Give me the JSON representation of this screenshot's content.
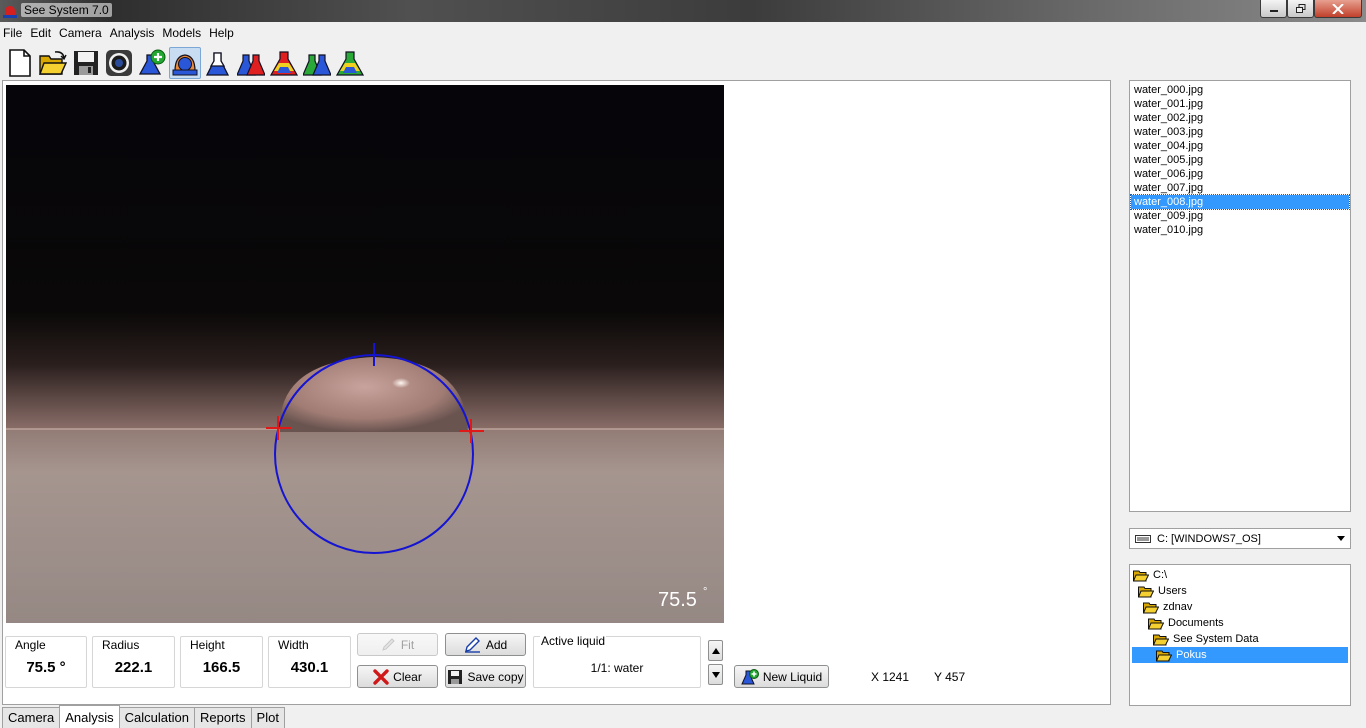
{
  "window": {
    "title": "See System 7.0"
  },
  "menu": [
    "File",
    "Edit",
    "Camera",
    "Analysis",
    "Models",
    "Help"
  ],
  "toolbar": {
    "icons": [
      "new-document-icon",
      "open-folder-icon",
      "save-disk-icon",
      "camera-lens-icon",
      "add-flask-icon",
      "drop-capture-icon",
      "blue-flask-icon",
      "blue-red-flask-icon",
      "red-yellow-flask-icon",
      "green-blue-flask-icon",
      "green-yellow-flask-icon"
    ],
    "pressed_index": 5
  },
  "image": {
    "angle_overlay": "75.5",
    "angle_unit": "°"
  },
  "measurements": {
    "angle": {
      "label": "Angle",
      "value": "75.5 °"
    },
    "radius": {
      "label": "Radius",
      "value": "222.1"
    },
    "height": {
      "label": "Height",
      "value": "166.5"
    },
    "width": {
      "label": "Width",
      "value": "430.1"
    }
  },
  "buttons": {
    "fit": "Fit",
    "add": "Add",
    "clear": "Clear",
    "save_copy": "Save copy",
    "new_liquid": "New Liquid"
  },
  "active_liquid": {
    "label": "Active liquid",
    "value": "1/1: water"
  },
  "coordinates": {
    "x": "X 1241",
    "y": "Y 457"
  },
  "files": [
    "water_000.jpg",
    "water_001.jpg",
    "water_002.jpg",
    "water_003.jpg",
    "water_004.jpg",
    "water_005.jpg",
    "water_006.jpg",
    "water_007.jpg",
    "water_008.jpg",
    "water_009.jpg",
    "water_010.jpg"
  ],
  "selected_file": "water_008.jpg",
  "drive": "C: [WINDOWS7_OS]",
  "directories": [
    {
      "name": "C:\\",
      "level": 0
    },
    {
      "name": "Users",
      "level": 1
    },
    {
      "name": "zdnav",
      "level": 2
    },
    {
      "name": "Documents",
      "level": 3
    },
    {
      "name": "See System Data",
      "level": 4
    },
    {
      "name": "Pokus",
      "level": 5,
      "selected": true
    }
  ],
  "tabs": [
    "Camera",
    "Analysis",
    "Calculation",
    "Reports",
    "Plot"
  ],
  "active_tab": "Analysis",
  "colors": {
    "selection": "#3399ff",
    "drop_fit_circle": "#1414d2",
    "contact_marker": "#e01818"
  }
}
